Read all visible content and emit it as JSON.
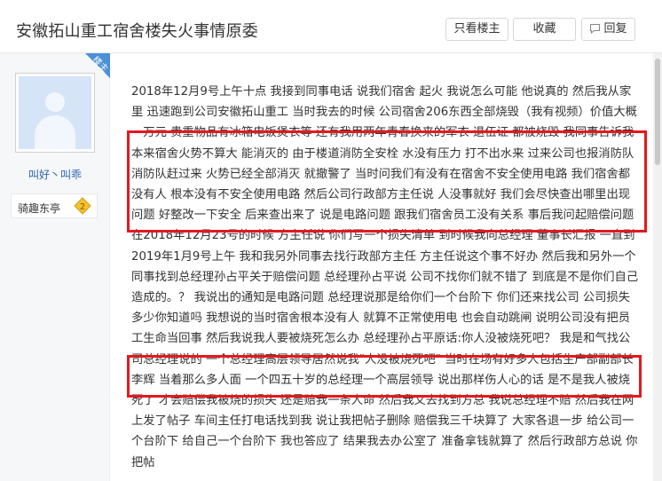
{
  "header": {
    "title": "安徽拓山重工宿舍楼失火事情原委",
    "buttons": {
      "owner_only": "只看楼主",
      "favorite": "收藏",
      "reply": "回复"
    }
  },
  "author": {
    "username": "叫好丶叫乖",
    "badge_label": "骑趣东亭",
    "badge_level": "2",
    "corner_label": "楼主"
  },
  "post": {
    "body": "2018年12月9号上午十点 我接到同事电话 说我们宿舍 起火 我说怎么可能 他说真的 然后我从家里 迅速跑到公司安徽拓山重工 当时我去的时候 公司宿舍206东西全部烧毁（我有视频）价值大概一万元 贵重物品有冰箱电饭煲衣等 还有我用两年青春换来的军衣 退伍证 都被烧毁 我同事告诉我 本来宿舍火势不算大 能消灭的 由于楼道消防全安栓 水没有压力 打不出水来 过来公司也报消防队 消防队赶过来 火势已经全部消灭 就撤警了 当时问我们有没有在宿舍不安全使用电路 我们宿舍都没有人 根本没有不安全使用电路 然后公司行政部方主任说 人没事就好 我们会尽快查出哪里出现问题 好整改一下安全 后来查出来了 说是电路问题 跟我们宿舍员工没有关系 事后我问起赔偿问题 在2018年12月23号的时候 方主任说 你们写一个损失清单 到时候我向总经理 董事长汇报 一直到2019年1月9号上午 我和我另外同事去找行政部方主任 方主任说这个事不好办 然后我和另外一个同事找到总经理孙占平关于赔偿问题 总经理孙占平说 公司不找你们就不错了 到底是不是你们自己造成的。？ 我说出的通知是电路问题 总经理说那是给你们一个台阶下 你们还来找公司 公司损失多少你知道吗 我想说的当时宿舍根本没有人 就算不正常使用电 也会自动跳闸 说明公司没有把员工生命当回事 然后我说我人要被烧死怎么办 总经理孙占平原话:你人没被烧死吧？ 我是和气找公司总经理说的 一个总经理高层领导居然说我\"人没被烧死吧\" 当时在场有好多人包括生产部副部长李辉 当着那么多人面 一个四五十岁的总经理一个高层领导 说出那样伤人心的话 是不是我人被烧死了 才会赔偿我被烧的损失 还是赔我一条人命 然后我又去找到方总 我说总经理不赔 然后我在网上发了帖子 车间主任打电话找到我 说让我把帖子删除 赔偿我三千块算了 大家各退一步 给公司一个台阶下 给自己一个台阶下 我也答应了 结果我去办公室了 准备拿钱就算了 然后行政部方总说 你把帖"
  },
  "colors": {
    "highlight": "#e4191d",
    "link": "#2d64b3",
    "corner": "#4a90d9",
    "sidebar_bg": "#f6f7f9"
  },
  "icons": {
    "reply": "speech-bubble-icon",
    "medal": "medal-icon",
    "avatar": "default-avatar-icon"
  }
}
